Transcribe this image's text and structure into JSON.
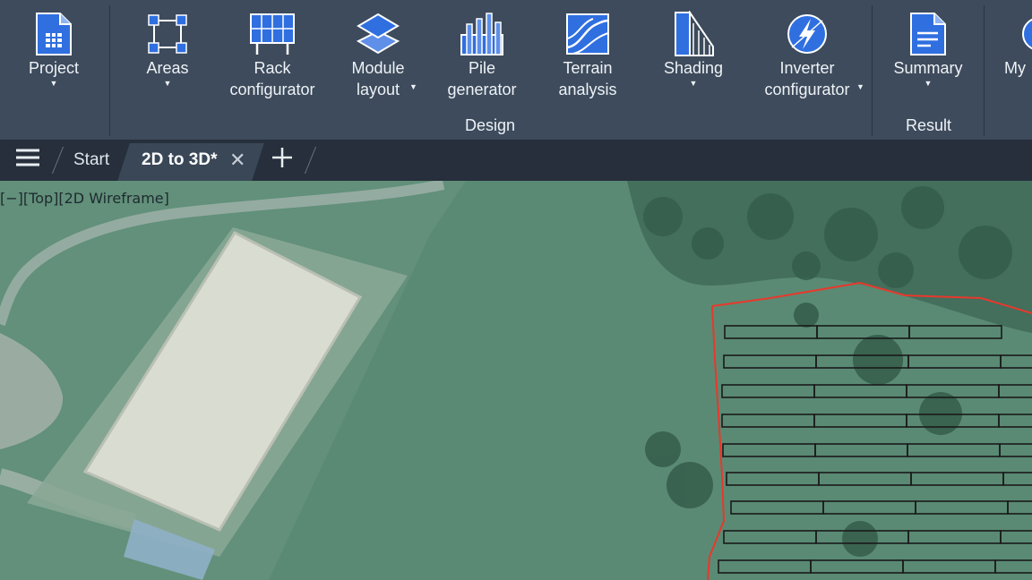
{
  "ribbon": {
    "buttons": [
      {
        "id": "project",
        "line1": "Project",
        "line2": ""
      },
      {
        "id": "areas",
        "line1": "Areas",
        "line2": ""
      },
      {
        "id": "rack",
        "line1": "Rack",
        "line2": "configurator"
      },
      {
        "id": "module",
        "line1": "Module",
        "line2": "layout"
      },
      {
        "id": "pile",
        "line1": "Pile",
        "line2": "generator"
      },
      {
        "id": "terrain",
        "line1": "Terrain",
        "line2": "analysis"
      },
      {
        "id": "shading",
        "line1": "Shading",
        "line2": ""
      },
      {
        "id": "inverter",
        "line1": "Inverter",
        "line2": "configurator"
      },
      {
        "id": "summary",
        "line1": "Summary",
        "line2": ""
      },
      {
        "id": "my",
        "line1": "My",
        "line2": ""
      }
    ],
    "groups": {
      "design": "Design",
      "result": "Result"
    },
    "colors": {
      "background": "#3d4b5c",
      "icon_blue": "#2f6fe0"
    }
  },
  "tabs": {
    "menu_icon": "hamburger-icon",
    "items": [
      {
        "label": "Start",
        "active": false
      },
      {
        "label": "2D to 3D*",
        "active": true
      }
    ],
    "close_icon": "close-icon",
    "new_tab_icon": "plus-icon"
  },
  "viewport": {
    "label": "[−][Top][2D Wireframe]",
    "boundary_color": "#e8382c",
    "row_color": "#1a1a1a"
  }
}
